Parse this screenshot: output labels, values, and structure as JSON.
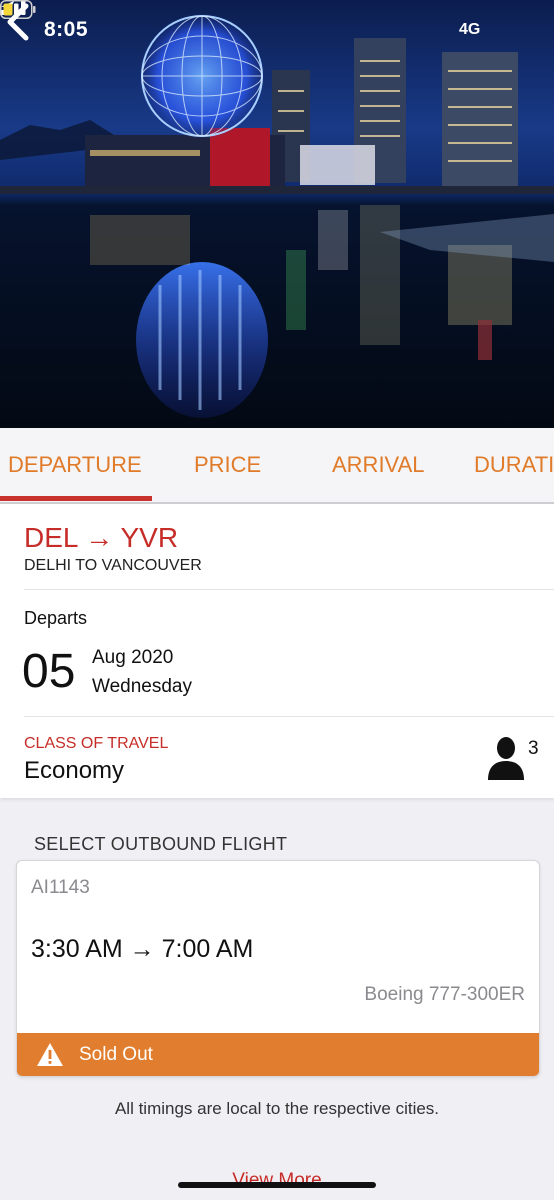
{
  "status_bar": {
    "time": "8:05",
    "network": "4G"
  },
  "tabs": [
    {
      "label": "DEPARTURE",
      "active": true
    },
    {
      "label": "PRICE",
      "active": false
    },
    {
      "label": "ARRIVAL",
      "active": false
    },
    {
      "label": "DURATI",
      "active": false
    }
  ],
  "trip": {
    "route_code": "DEL → YVR",
    "route_cities": "DELHI TO VANCOUVER",
    "departs_label": "Departs",
    "day": "05",
    "month_year": "Aug 2020",
    "weekday": "Wednesday",
    "class_label": "CLASS OF TRAVEL",
    "class_value": "Economy",
    "passengers": "3"
  },
  "outbound": {
    "section_title": "SELECT OUTBOUND FLIGHT",
    "flight_number": "AI1143",
    "times": "3:30 AM → 7:00 AM",
    "aircraft": "Boeing 777-300ER",
    "status": "Sold Out"
  },
  "footer": {
    "timings_note": "All timings are local to the respective cities.",
    "view_more": "View More"
  },
  "colors": {
    "accent_red": "#c62d28",
    "tab_orange": "#e07b2a",
    "sold_out_orange": "#e07d2e"
  }
}
